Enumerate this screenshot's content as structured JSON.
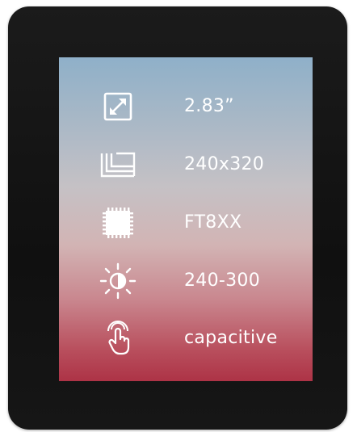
{
  "specs": [
    {
      "icon": "screen-size-icon",
      "label": "2.83”"
    },
    {
      "icon": "resolution-icon",
      "label": "240x320"
    },
    {
      "icon": "chip-icon",
      "label": "FT8XX"
    },
    {
      "icon": "brightness-icon",
      "label": "240-300"
    },
    {
      "icon": "touch-icon",
      "label": "capacitive"
    }
  ],
  "colors": {
    "bezel": "#141414",
    "screen_top": "#8fb0c9",
    "screen_bottom": "#ad3346",
    "text": "#ffffff"
  }
}
